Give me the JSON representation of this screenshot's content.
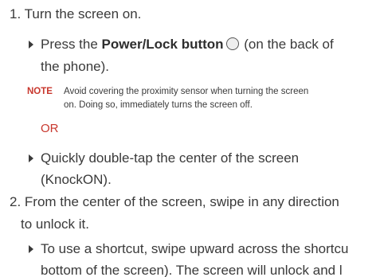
{
  "steps": [
    {
      "number": "1.",
      "text": "Turn the screen on.",
      "bullets": [
        {
          "prefix": "Press the ",
          "bold": "Power/Lock button",
          "icon": "power-button-icon",
          "suffix": " (on the back of",
          "continuation": "the phone)."
        },
        {
          "line1": "Quickly double-tap the center of the screen",
          "line2": "(KnockON)."
        }
      ],
      "note": {
        "label": "NOTE",
        "line1": "Avoid covering the proximity sensor when turning the screen",
        "line2": "on. Doing so, immediately turns the screen off."
      },
      "or_label": "OR"
    },
    {
      "number": "2.",
      "line1": "From the center of the screen, swipe in any direction",
      "line2": "to unlock it.",
      "bullets": [
        {
          "line1": "To use a shortcut, swipe upward across the shortcu",
          "line2": "bottom of the screen). The screen will unlock and l"
        }
      ]
    }
  ],
  "colors": {
    "text": "#3a3a3a",
    "accent": "#c8372d"
  }
}
